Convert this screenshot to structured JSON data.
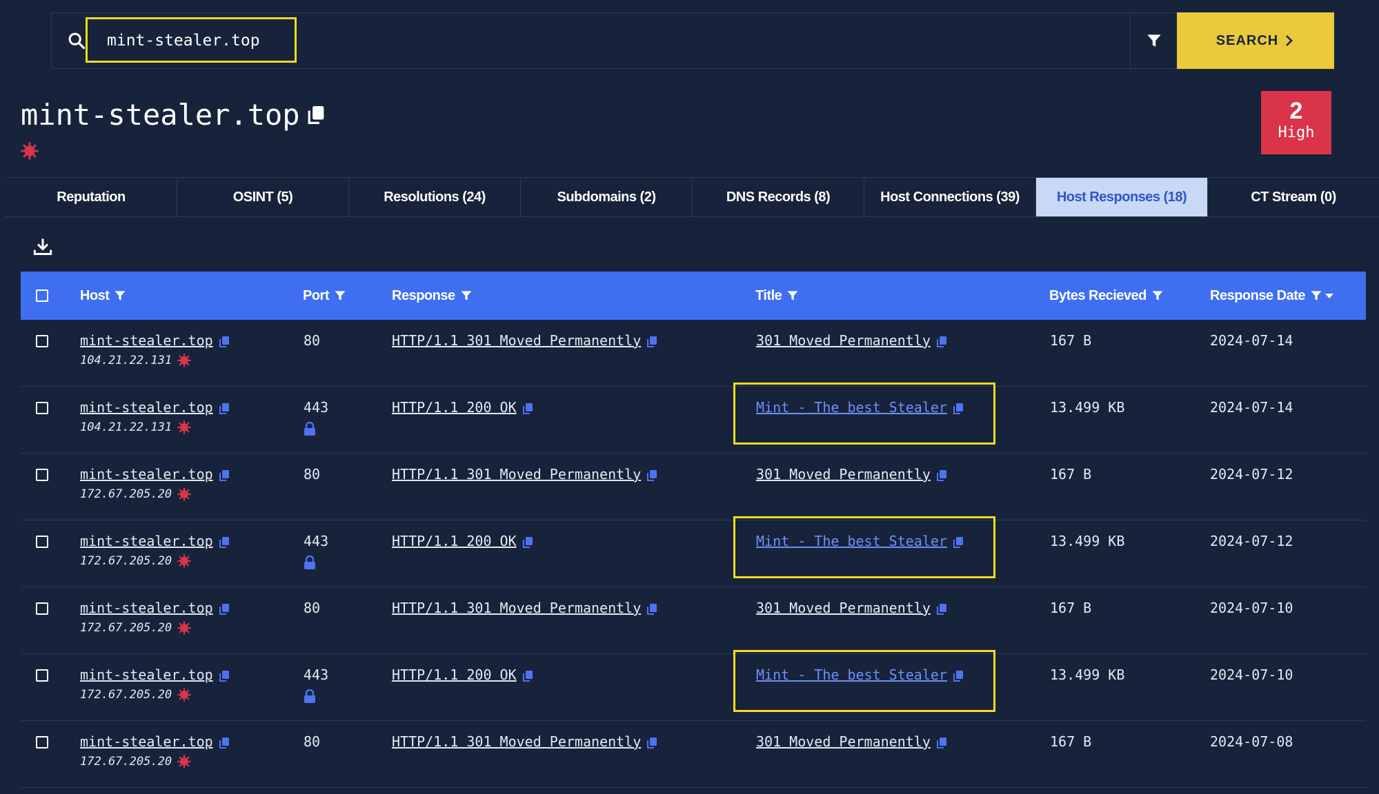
{
  "search": {
    "value": "mint-stealer.top",
    "button_label": "SEARCH"
  },
  "page": {
    "title": "mint-stealer.top"
  },
  "score": {
    "value": "2",
    "label": "High"
  },
  "tabs": [
    {
      "label": "Reputation"
    },
    {
      "label": "OSINT (5)"
    },
    {
      "label": "Resolutions (24)"
    },
    {
      "label": "Subdomains (2)"
    },
    {
      "label": "DNS Records (8)"
    },
    {
      "label": "Host Connections (39)"
    },
    {
      "label": "Host Responses (18)"
    },
    {
      "label": "CT Stream (0)"
    }
  ],
  "table": {
    "headers": {
      "host": "Host",
      "port": "Port",
      "response": "Response",
      "title": "Title",
      "bytes": "Bytes Recieved",
      "date": "Response Date"
    },
    "rows": [
      {
        "host": "mint-stealer.top",
        "ip": "104.21.22.131",
        "port": "80",
        "response": "HTTP/1.1 301 Moved Permanently",
        "title": "301 Moved Permanently",
        "bytes": "167 B",
        "date": "2024-07-14"
      },
      {
        "host": "mint-stealer.top",
        "ip": "104.21.22.131",
        "port": "443",
        "response": "HTTP/1.1 200 OK",
        "title": "Mint - The best Stealer",
        "bytes": "13.499 KB",
        "date": "2024-07-14"
      },
      {
        "host": "mint-stealer.top",
        "ip": "172.67.205.20",
        "port": "80",
        "response": "HTTP/1.1 301 Moved Permanently",
        "title": "301 Moved Permanently",
        "bytes": "167 B",
        "date": "2024-07-12"
      },
      {
        "host": "mint-stealer.top",
        "ip": "172.67.205.20",
        "port": "443",
        "response": "HTTP/1.1 200 OK",
        "title": "Mint - The best Stealer",
        "bytes": "13.499 KB",
        "date": "2024-07-12"
      },
      {
        "host": "mint-stealer.top",
        "ip": "172.67.205.20",
        "port": "80",
        "response": "HTTP/1.1 301 Moved Permanently",
        "title": "301 Moved Permanently",
        "bytes": "167 B",
        "date": "2024-07-10"
      },
      {
        "host": "mint-stealer.top",
        "ip": "172.67.205.20",
        "port": "443",
        "response": "HTTP/1.1 200 OK",
        "title": "Mint - The best Stealer",
        "bytes": "13.499 KB",
        "date": "2024-07-10"
      },
      {
        "host": "mint-stealer.top",
        "ip": "172.67.205.20",
        "port": "80",
        "response": "HTTP/1.1 301 Moved Permanently",
        "title": "301 Moved Permanently",
        "bytes": "167 B",
        "date": "2024-07-08"
      }
    ]
  },
  "colors": {
    "background": "#17233a",
    "accent": "#3f6ff0",
    "search_button": "#eac93a",
    "score_badge": "#d9344a",
    "highlight": "#f2dc1e",
    "malware": "#d9344a",
    "link_blue": "#6f8ff8"
  }
}
